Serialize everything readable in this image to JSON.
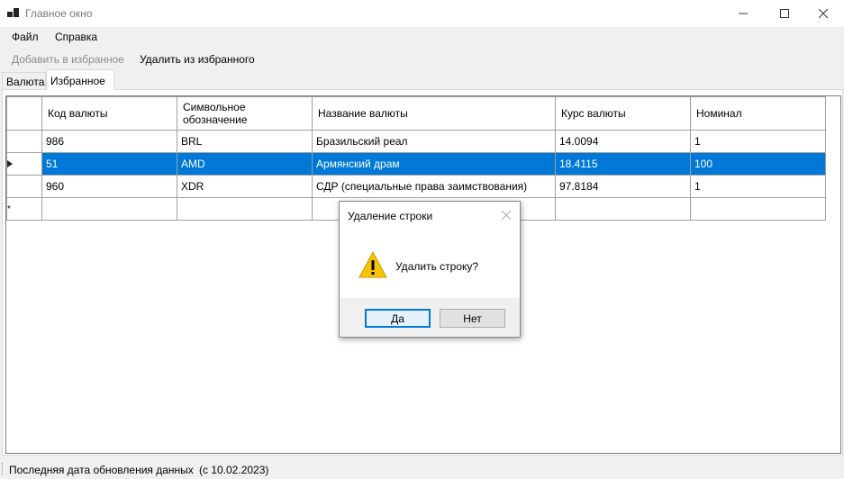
{
  "window": {
    "title": "Главное окно",
    "icon": "app-window-icon",
    "controls": {
      "minimize": "minimize-icon",
      "maximize": "maximize-icon",
      "close": "close-icon"
    }
  },
  "menu": {
    "items": [
      {
        "label": "Файл"
      },
      {
        "label": "Справка"
      }
    ]
  },
  "toolbar": {
    "add_favorite": "Добавить в избранное",
    "remove_favorite": "Удалить из избранного",
    "add_enabled": false
  },
  "tabs": [
    {
      "label": "Валюта",
      "active": false
    },
    {
      "label": "Избранное",
      "active": true
    }
  ],
  "grid": {
    "columns": [
      "Код валюты",
      "Символьное\nобозначение",
      "Название валюты",
      "Курс валюты",
      "Номинал"
    ],
    "rows": [
      {
        "code": "986",
        "symbol": "BRL",
        "name": "Бразильский реал",
        "rate": "14.0094",
        "nominal": "1",
        "selected": false
      },
      {
        "code": "51",
        "symbol": "AMD",
        "name": "Армянский драм",
        "rate": "18.4115",
        "nominal": "100",
        "selected": true
      },
      {
        "code": "960",
        "symbol": "XDR",
        "name": "СДР (специальные права заимствования)",
        "rate": "97.8184",
        "nominal": "1",
        "selected": false
      }
    ],
    "new_row_marker": "*",
    "current_row_marker": "triangle-right-icon",
    "selection_color": "#0078d7"
  },
  "status": {
    "label": "Последняя дата обновления данных",
    "date": "(с 10.02.2023)"
  },
  "dialog": {
    "title": "Удаление строки",
    "message": "Удалить строку?",
    "icon": "warning-icon",
    "yes_label": "Да",
    "no_label": "Нет",
    "accent": "#0078d7"
  }
}
